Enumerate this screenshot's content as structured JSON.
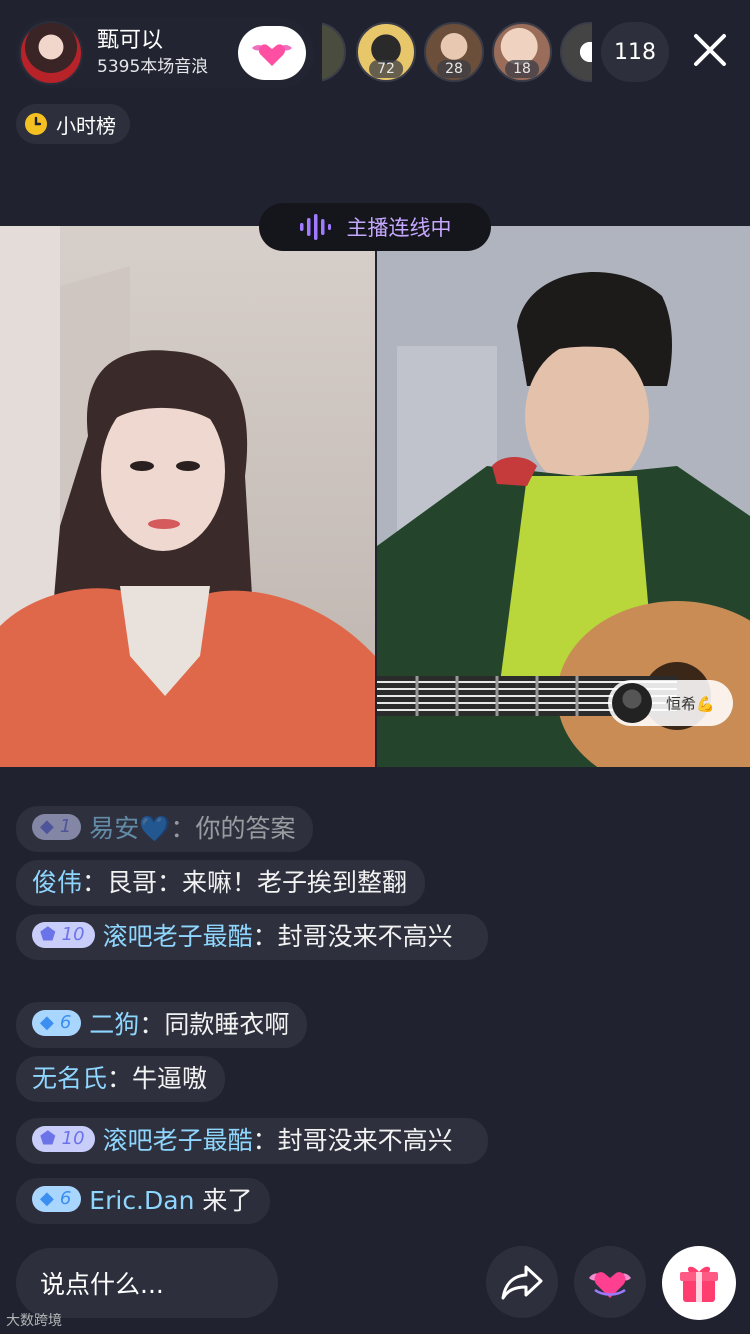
{
  "host": {
    "name": "甄可以",
    "stats": "5395本场音浪"
  },
  "viewers": [
    {
      "badge": ""
    },
    {
      "badge": "72"
    },
    {
      "badge": "28"
    },
    {
      "badge": "18"
    },
    {
      "badge": ""
    }
  ],
  "viewer_count": "118",
  "hour_rank": "小时榜",
  "link": {
    "status": "主播连线中",
    "guest_name": "恒希💪"
  },
  "chat": [
    {
      "level": "1",
      "user": "易安💙",
      "sep": "：",
      "text": "你的答案"
    },
    {
      "level": "",
      "user": "俊伟",
      "sep": "：",
      "text": "艮哥：来嘛！老子挨到整翻"
    },
    {
      "level": "10",
      "user": "滚吧老子最酷",
      "sep": "：",
      "text": "封哥没来不高兴"
    },
    {
      "level": "6",
      "user": "二狗",
      "sep": "：",
      "text": "同款睡衣啊"
    },
    {
      "level": "",
      "user": "无名氏",
      "sep": "：",
      "text": "牛逼嗷"
    },
    {
      "level": "10",
      "user": "滚吧老子最酷",
      "sep": "：",
      "text": "封哥没来不高兴"
    },
    {
      "level": "6",
      "user": "Eric.Dan",
      "sep": " ",
      "text": "来了"
    }
  ],
  "input": {
    "placeholder": "说点什么..."
  },
  "watermark": "大数跨境",
  "colors": {
    "background": "#20232f",
    "pill": "#2d303c",
    "username": "#8fd6ff",
    "link_text": "#c6a8ff"
  }
}
